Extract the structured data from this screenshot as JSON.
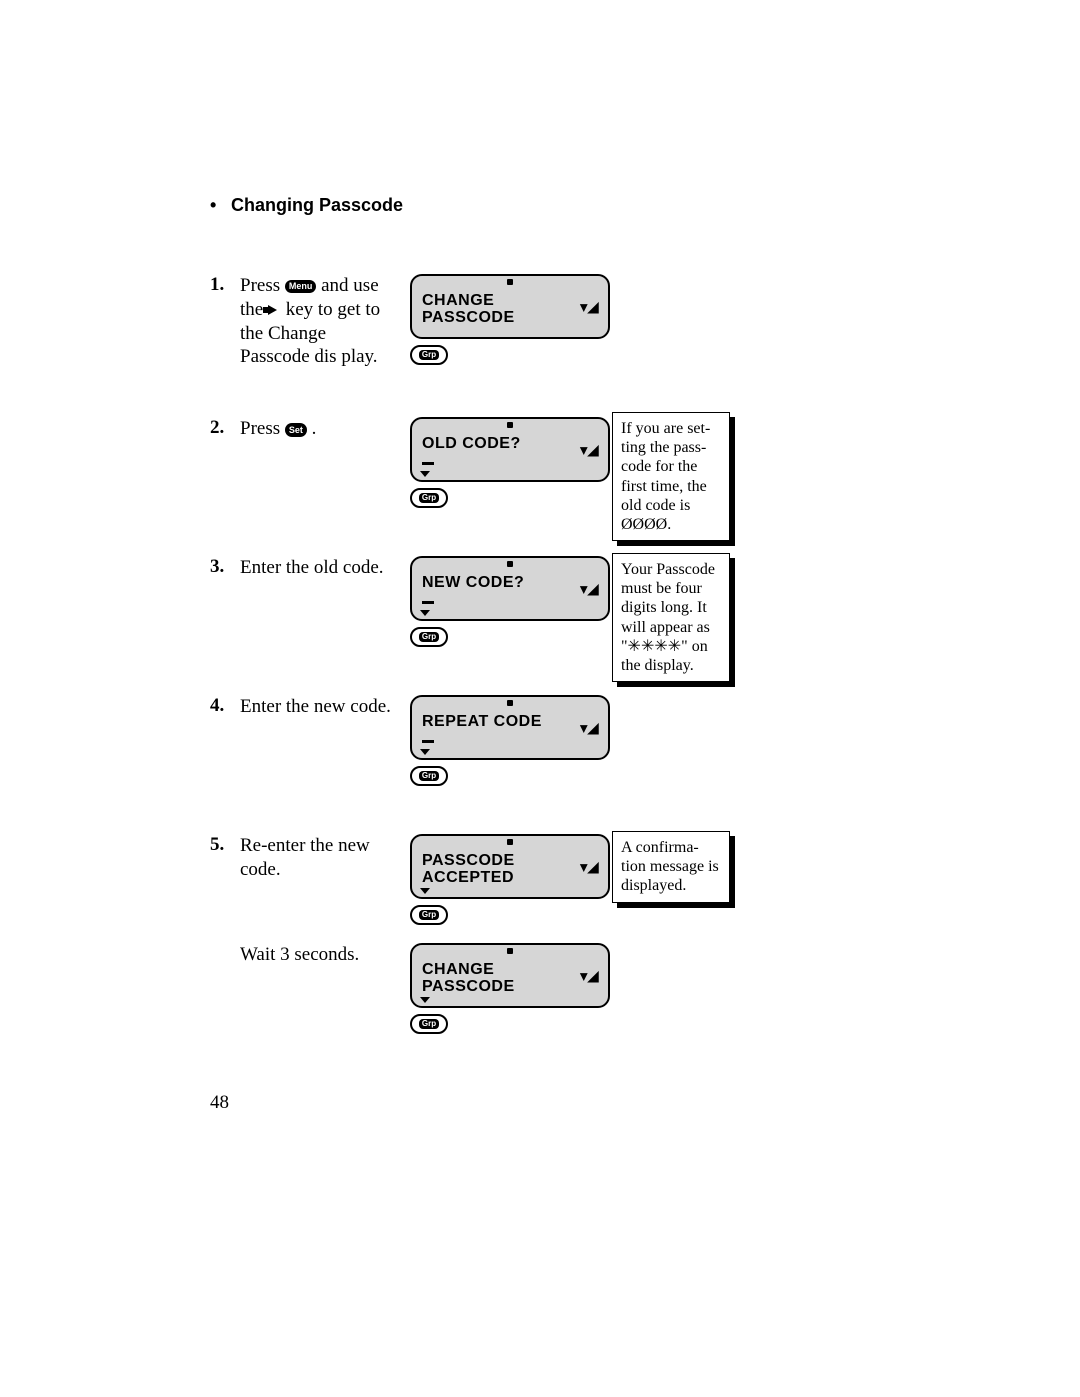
{
  "title": "Changing Passcode",
  "icons": {
    "menu_label": "Menu",
    "set_label": "Set",
    "grp_label": "Grp",
    "antenna": "▾◢"
  },
  "steps": [
    {
      "num": "1.",
      "instr_pre": "Press ",
      "instr_icon": "menu",
      "instr_mid": " and use the ",
      "instr_icon2": "arrow",
      "instr_post": " key to get to the Change Passcode dis play.",
      "screen": {
        "line1": "CHANGE",
        "line2": "PASSCODE",
        "cursor": false,
        "arrow": false
      },
      "note": null
    },
    {
      "num": "2.",
      "instr_pre": "Press ",
      "instr_icon": "set",
      "instr_mid": " .",
      "instr_icon2": null,
      "instr_post": "",
      "screen": {
        "line1": "OLD CODE?",
        "line2": "",
        "cursor": true,
        "arrow": true
      },
      "note": "If you are set- ting the pass- code for the first time, the old code is ØØØØ."
    },
    {
      "num": "3.",
      "instr_pre": "Enter the old code.",
      "instr_icon": null,
      "instr_mid": "",
      "instr_icon2": null,
      "instr_post": "",
      "screen": {
        "line1": "NEW CODE?",
        "line2": "",
        "cursor": true,
        "arrow": true
      },
      "note": "Your Passcode must be four digits long. It will appear as \"✳✳✳✳\" on the display."
    },
    {
      "num": "4.",
      "instr_pre": "Enter the new code.",
      "instr_icon": null,
      "instr_mid": "",
      "instr_icon2": null,
      "instr_post": "",
      "screen": {
        "line1": "REPEAT CODE",
        "line2": "",
        "cursor": true,
        "arrow": true
      },
      "note": null
    },
    {
      "num": "5.",
      "instr_pre": "Re-enter the new code.",
      "instr_icon": null,
      "instr_mid": "",
      "instr_icon2": null,
      "instr_post": "",
      "screen": {
        "line1": "PASSCODE",
        "line2": "ACCEPTED",
        "cursor": false,
        "arrow": true
      },
      "note": "A confirma- tion message is displayed."
    },
    {
      "num": "",
      "instr_pre": "Wait 3 seconds.",
      "instr_icon": null,
      "instr_mid": "",
      "instr_icon2": null,
      "instr_post": "",
      "screen": {
        "line1": "CHANGE",
        "line2": "PASSCODE",
        "cursor": false,
        "arrow": true
      },
      "note": null
    }
  ],
  "page_number": "48"
}
